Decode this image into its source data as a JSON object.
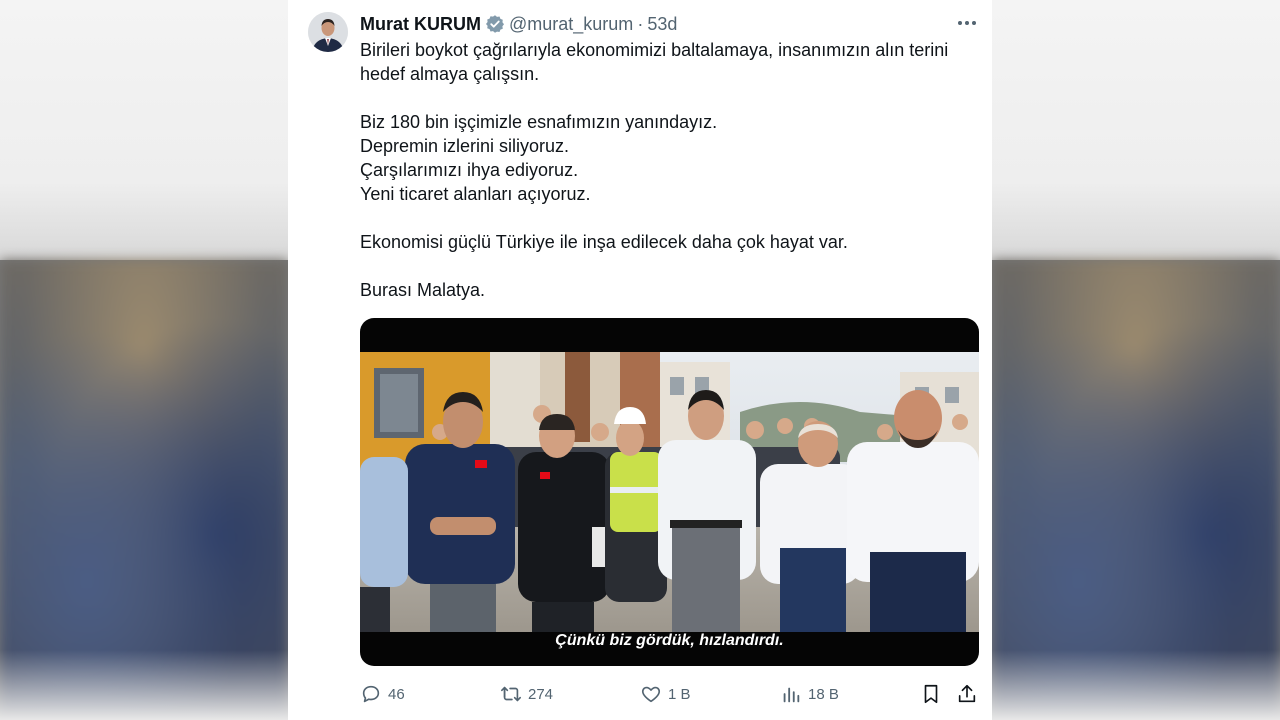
{
  "tweet": {
    "author_name": "Murat KURUM",
    "handle": "@murat_kurum",
    "separator": "·",
    "time": "53d",
    "verified_icon": "verified-badge-icon",
    "more_icon": "more-horizontal-icon",
    "text_lines": [
      "Birileri boykot çağrılarıyla ekonomimizi baltalamaya, insanımızın alın terini hedef almaya çalışsın.",
      "Biz 180 bin işçimizle esnafımızın yanındayız.",
      "Depremin izlerini siliyoruz.",
      "Çarşılarımızı ihya ediyoruz.",
      "Yeni ticaret alanları açıyoruz.",
      "Ekonomisi güçlü Türkiye ile inşa edilecek daha çok hayat var.",
      "Burası Malatya."
    ],
    "media": {
      "caption": "Çünkü biz gördük, hızlandırdı."
    },
    "actions": {
      "replies": "46",
      "retweets": "274",
      "likes": "1 B",
      "views": "18 B"
    }
  },
  "colors": {
    "text": "#0f1419",
    "muted": "#536471",
    "verified": "#829aab"
  }
}
